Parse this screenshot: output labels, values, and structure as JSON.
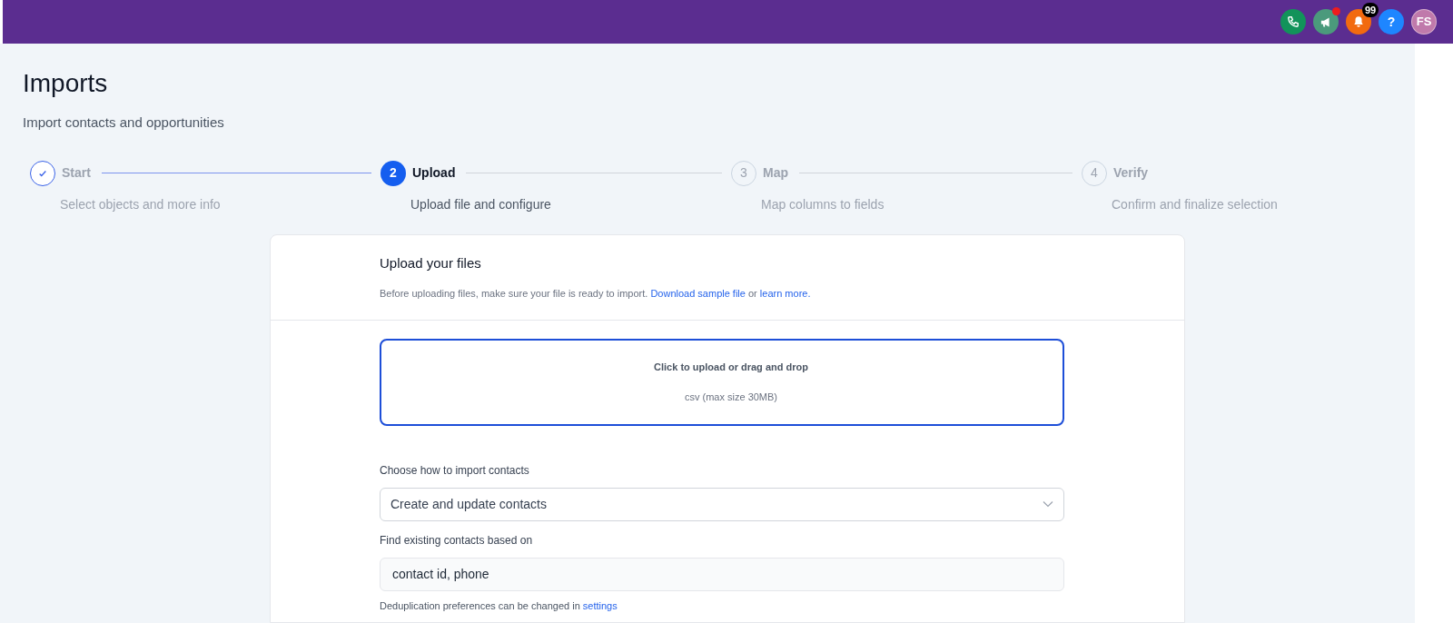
{
  "top_bar": {
    "actions": [
      {
        "kind": "phone",
        "color": "#12935a",
        "dot": false
      },
      {
        "kind": "megaphone",
        "color": "#4b9a7c",
        "dot": true
      },
      {
        "kind": "bell",
        "color": "#f26a0f",
        "dot": false,
        "badge": "99"
      },
      {
        "kind": "help",
        "color": "#1e86ff",
        "dot": false,
        "label": "?"
      },
      {
        "kind": "avatar",
        "color": "#c07aab",
        "dot": false,
        "label": "FS"
      }
    ]
  },
  "page": {
    "title": "Imports",
    "subtitle": "Import contacts and opportunities"
  },
  "steps": [
    {
      "label": "Start",
      "description": "Select objects and more info",
      "completed": true,
      "selected": false
    },
    {
      "number": "2",
      "label": "Upload",
      "description": "Upload file and configure",
      "completed": false,
      "selected": true
    },
    {
      "number": "3",
      "label": "Map",
      "description": "Map columns to fields",
      "completed": false,
      "selected": false
    },
    {
      "number": "4",
      "label": "Verify",
      "description": "Confirm and finalize selection",
      "completed": false,
      "selected": false
    }
  ],
  "card": {
    "title": "Upload your files",
    "intro": "Before uploading files, make sure your file is ready to import.",
    "link_sample": "Download sample file",
    "or": "or",
    "link_learn": "learn more.",
    "dropzone": {
      "title": "Click to upload or drag and drop",
      "hint": "csv (max size 30MB)"
    },
    "import_mode": {
      "label": "Choose how to import contacts",
      "value": "Create and update contacts"
    },
    "match": {
      "label": "Find existing contacts based on",
      "value": "contact id, phone"
    },
    "note": "Deduplication preferences can be changed in",
    "note_link": "settings"
  }
}
